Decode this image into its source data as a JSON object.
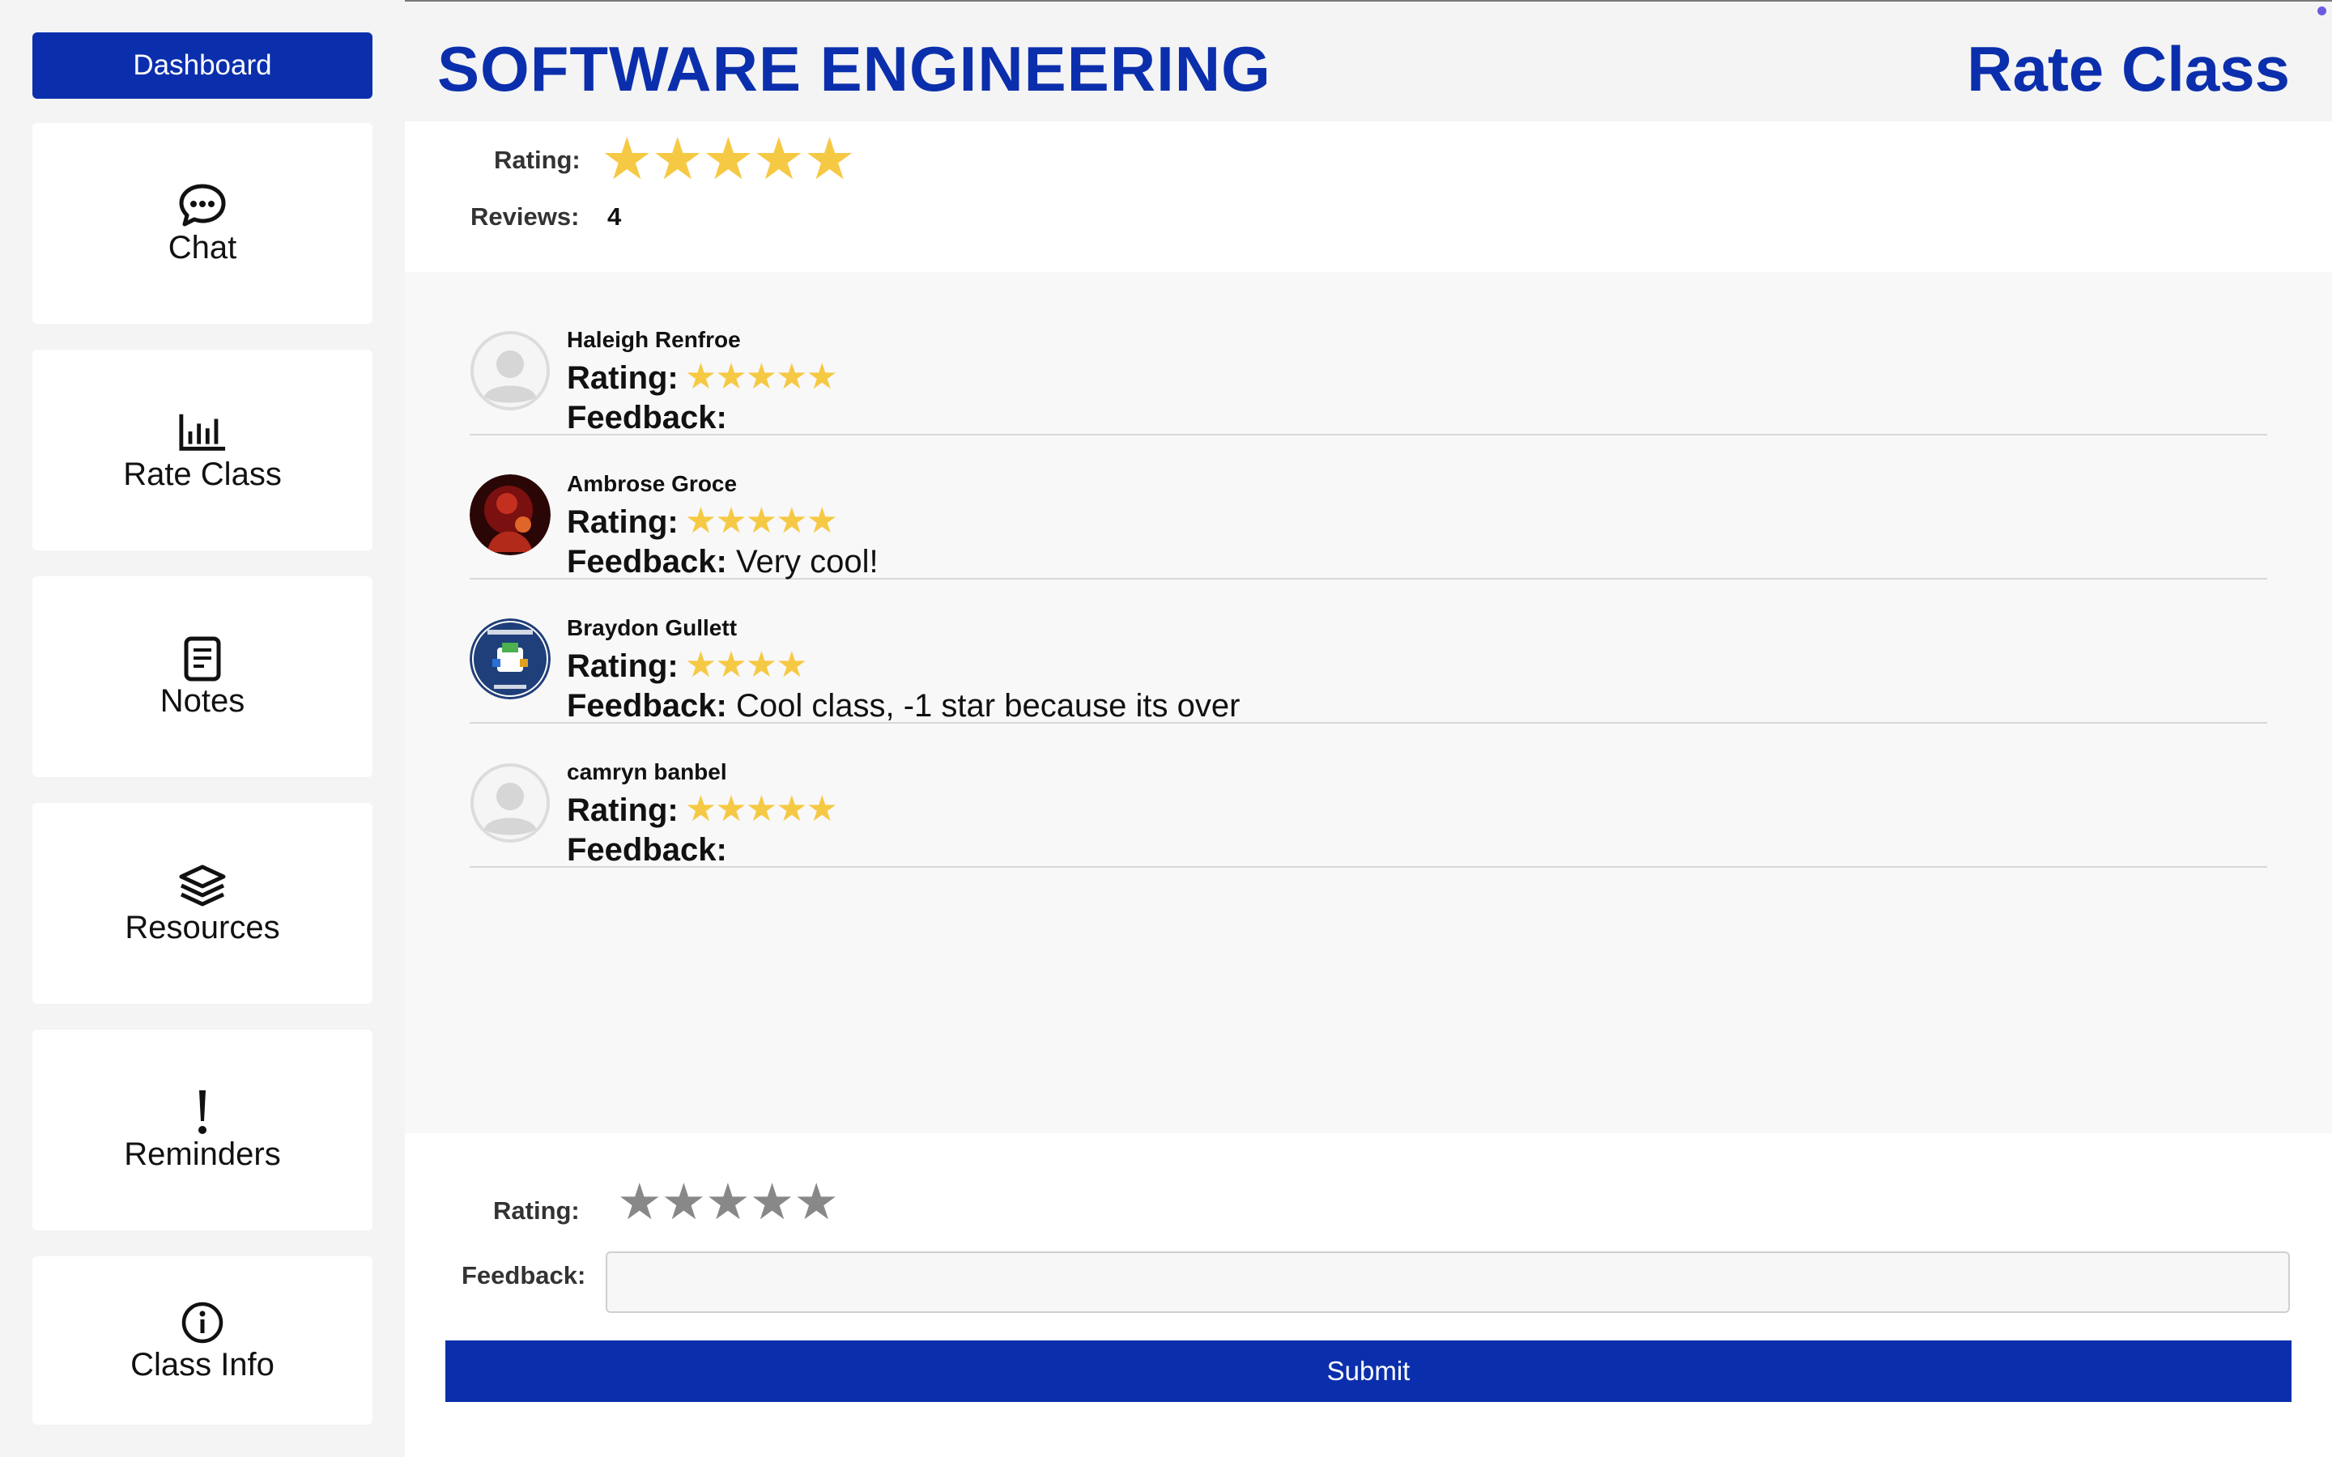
{
  "header": {
    "course_title": "SOFTWARE ENGINEERING",
    "page_title": "Rate Class"
  },
  "sidebar": {
    "dashboard_label": "Dashboard",
    "items": [
      {
        "label": "Chat",
        "icon": "chat-bubble-icon"
      },
      {
        "label": "Rate Class",
        "icon": "bar-chart-icon"
      },
      {
        "label": "Notes",
        "icon": "notes-icon"
      },
      {
        "label": "Resources",
        "icon": "layers-icon"
      },
      {
        "label": "Reminders",
        "icon": "exclamation-icon"
      },
      {
        "label": "Class Info",
        "icon": "info-icon"
      }
    ]
  },
  "summary": {
    "rating_label": "Rating:",
    "rating_stars": "★★★★★",
    "reviews_label": "Reviews:",
    "reviews_count": "4"
  },
  "reviews": [
    {
      "name": "Haleigh Renfroe",
      "rating_label": "Rating:",
      "stars": "★★★★★",
      "feedback_label": "Feedback:",
      "feedback": "",
      "avatar": "default-avatar-icon"
    },
    {
      "name": "Ambrose Groce",
      "rating_label": "Rating:",
      "stars": "★★★★★",
      "feedback_label": "Feedback:",
      "feedback": "Very cool!",
      "avatar": "photo-avatar"
    },
    {
      "name": "Braydon Gullett",
      "rating_label": "Rating:",
      "stars": "★★★★",
      "feedback_label": "Feedback:",
      "feedback": "Cool class, -1 star because its over",
      "avatar": "gaming-logo-avatar"
    },
    {
      "name": "camryn banbel",
      "rating_label": "Rating:",
      "stars": "★★★★★",
      "feedback_label": "Feedback:",
      "feedback": "",
      "avatar": "default-avatar-icon"
    }
  ],
  "form": {
    "rating_label": "Rating:",
    "rating_stars": "★★★★★",
    "feedback_label": "Feedback:",
    "feedback_value": "",
    "submit_label": "Submit"
  },
  "colors": {
    "brand": "#0b2fac",
    "star": "#f6c945",
    "star_empty": "#888888"
  }
}
